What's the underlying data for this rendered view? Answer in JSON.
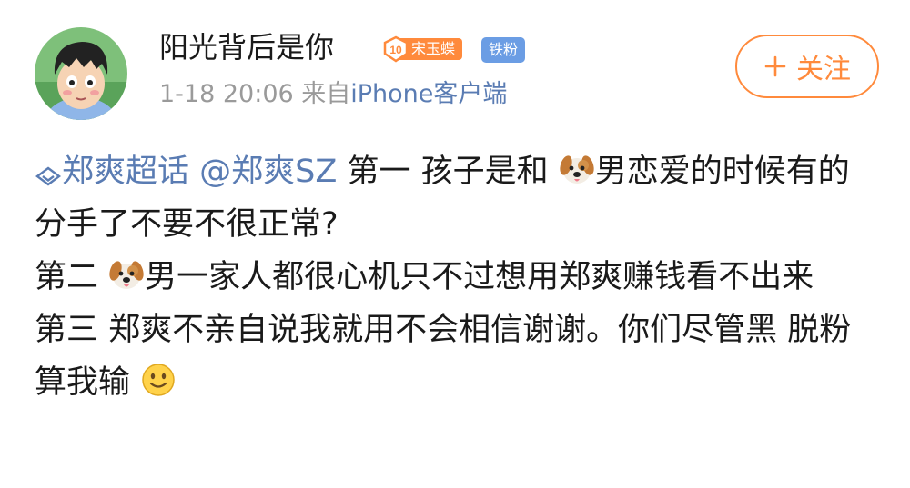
{
  "user": {
    "name": "阳光背后是你",
    "fan_badge": {
      "level": "10",
      "name": "宋玉蝶"
    },
    "iron_badge": "铁粉",
    "time": "1-18 20:06",
    "source_prefix": "来自",
    "source": "iPhone客户端"
  },
  "follow_button": {
    "label": "关注",
    "icon": "plus-icon"
  },
  "post": {
    "topic": "郑爽超话",
    "mention": "@郑爽SZ",
    "p1_text_a": " 第一 孩子是和",
    "p1_text_b": "男恋爱的时候有的分手了不要不很正常?",
    "p2_text_a": "第二  ",
    "p2_text_b": "男一家人都很心机只不过想用郑爽赚钱看不出来",
    "p3_text": " 第三 郑爽不亲自说我就用不会相信谢谢。你们尽管黑 脱粉算我输",
    "emoji_dog": "dog-face-icon",
    "emoji_smile": "smile-face-icon"
  },
  "colors": {
    "accent": "#ff8a3c",
    "link": "#5a7cb3",
    "meta": "#9a9a9a",
    "iron": "#6b9de4"
  }
}
